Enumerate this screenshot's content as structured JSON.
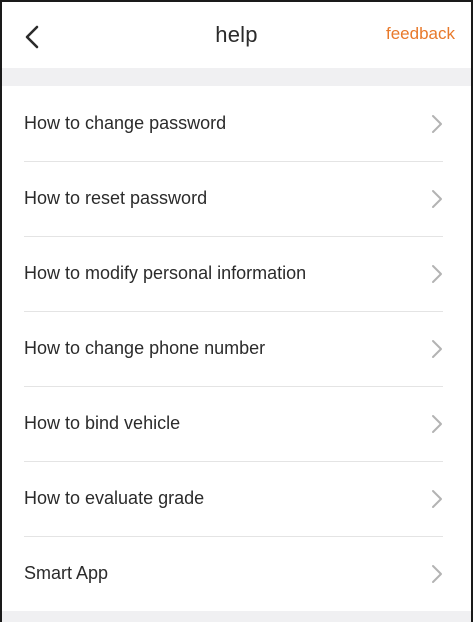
{
  "header": {
    "title": "help",
    "feedback_label": "feedback",
    "back_icon": "chevron-left-icon"
  },
  "items": [
    {
      "label": "How to change password"
    },
    {
      "label": "How to reset password"
    },
    {
      "label": "How to modify personal information"
    },
    {
      "label": "How to change phone number"
    },
    {
      "label": "How to bind vehicle"
    },
    {
      "label": "How to evaluate grade"
    },
    {
      "label": "Smart App"
    }
  ],
  "colors": {
    "accent": "#e8792a",
    "divider": "#e4e4e4",
    "section_bg": "#f0f0f2",
    "chevron": "#b3b3b3"
  }
}
